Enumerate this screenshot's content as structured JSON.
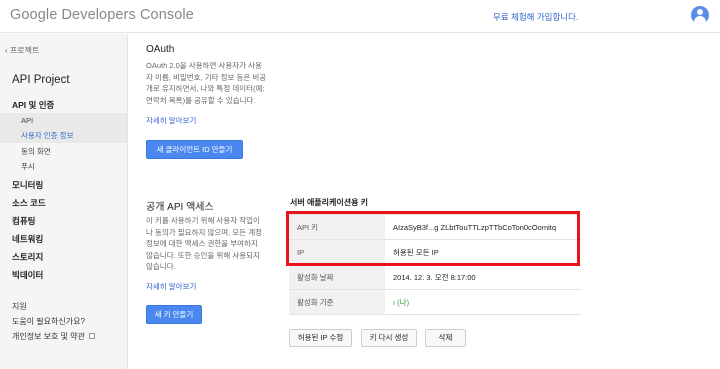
{
  "header": {
    "logo": "Google Developers Console",
    "trial_link": "무료 체험해 가입합니다."
  },
  "sidebar": {
    "back_label": "프로젝트",
    "project_title": "API Project",
    "items": [
      {
        "label": "API 및 인증"
      },
      {
        "label": "API"
      },
      {
        "label": "사용자 인증 정보"
      },
      {
        "label": "동의 화면"
      },
      {
        "label": "푸시"
      },
      {
        "label": "모니터링"
      },
      {
        "label": "소스 코드"
      },
      {
        "label": "컴퓨팅"
      },
      {
        "label": "네트워킹"
      },
      {
        "label": "스토리지"
      },
      {
        "label": "빅데이터"
      }
    ],
    "support": {
      "heading": "지원",
      "help": "도움이 필요하신가요?",
      "privacy": "개인정보 보호 및 약관"
    }
  },
  "oauth": {
    "title": "OAuth",
    "desc": [
      "OAuth 2.0을 사용하면 사용자가 사용",
      "자 이름, 비밀번호, 기타 정보 등은 비공",
      "개로 유지하면서, 나와 특정 데이터(예:",
      "연락처 목록)를 공유할 수 있습니다."
    ],
    "learn_more": "자세히 알아보기",
    "create_button": "새 클라이언트 ID 만들기"
  },
  "public_api": {
    "title": "공개 API 액세스",
    "desc": [
      "이 키를 사용하기 위해 사용자 작업이",
      "나 동의가 필요하지 않으며, 모든 계정",
      "정보에 대한 액세스 권한을 부여하지",
      "않습니다. 또한 승인을 위해 사용되지",
      "않습니다."
    ],
    "learn_more": "자세히 알아보기",
    "create_button": "새 키 만들기"
  },
  "server_key": {
    "title": "서버 애플리케이션용 키",
    "rows": [
      {
        "key": "API 키",
        "value": "AIzaSyB3f...g ZLbtTouTTLzpTTbCoTon0cOomitq"
      },
      {
        "key": "IP",
        "value": "허용된 모든 IP"
      },
      {
        "key": "활성화 날짜",
        "value": "2014. 12. 3. 오전 8:17:00"
      },
      {
        "key": "활성화 기준",
        "value": "ı (나)"
      }
    ],
    "buttons": {
      "edit_ips": "허용된 IP 수정",
      "regenerate": "키 다시 생성",
      "delete": "삭제"
    }
  },
  "colors": {
    "primary_button": "#4a87ee",
    "link": "#3366cc",
    "highlight": "#e8141c"
  }
}
